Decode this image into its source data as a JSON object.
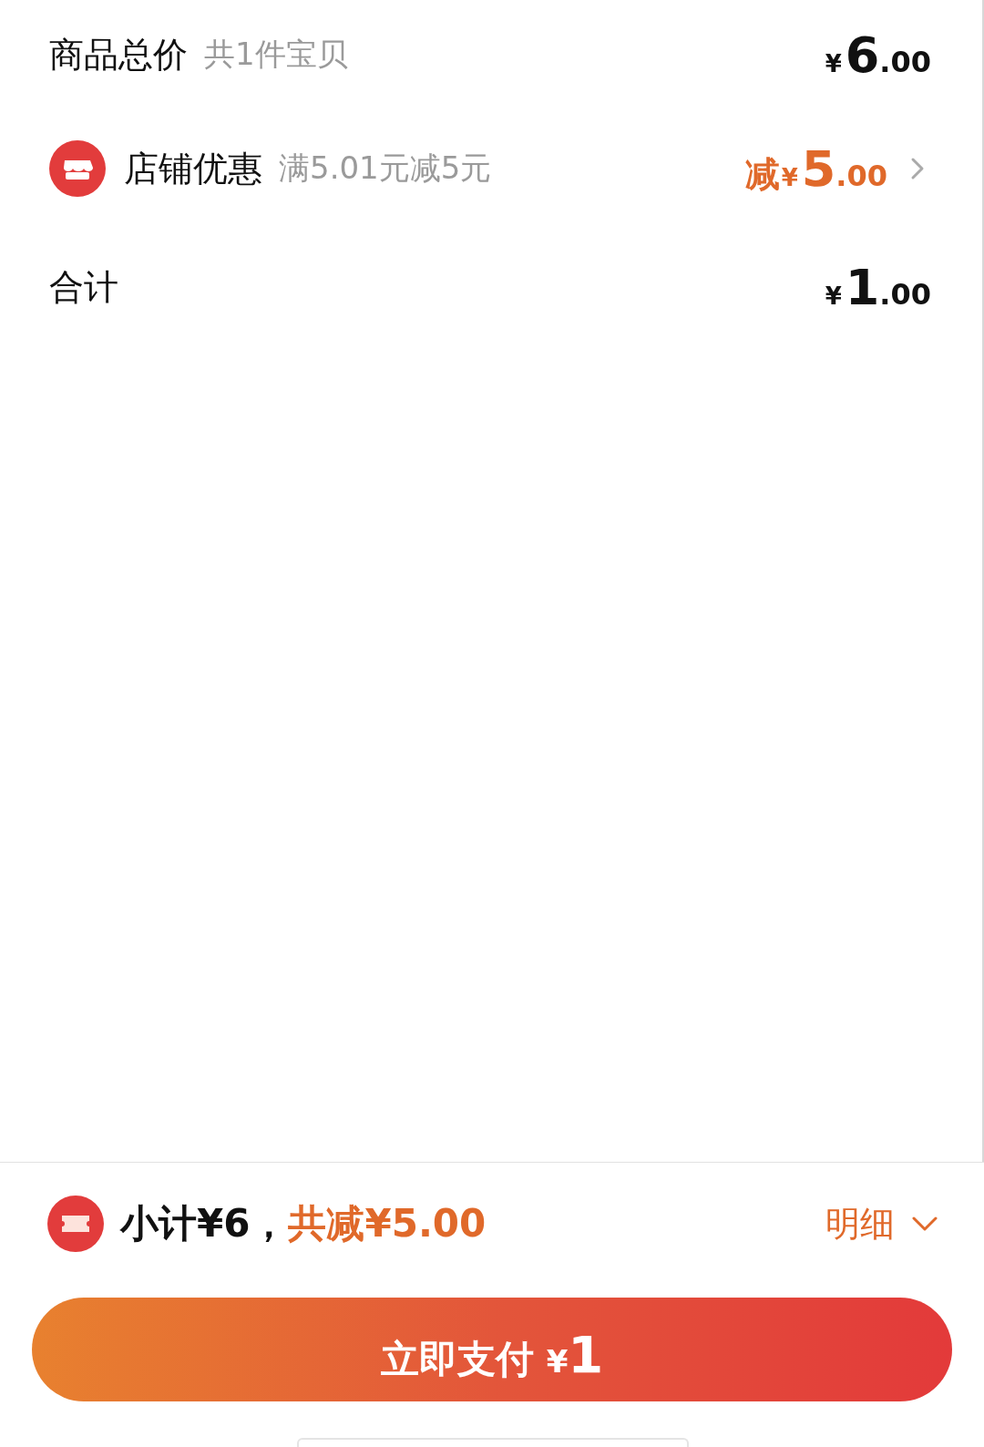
{
  "summary": [
    {
      "kind": "plain",
      "label": "商品总价",
      "note": "共1件宝贝",
      "price": {
        "symbol": "¥",
        "integer": "6",
        "decimal": ".00"
      }
    },
    {
      "kind": "discount",
      "label": "店铺优惠",
      "note": "满5.01元减5元",
      "price": {
        "prefix": "减",
        "symbol": "¥",
        "integer": "5",
        "decimal": ".00"
      }
    },
    {
      "kind": "plain",
      "label": "合计",
      "price": {
        "symbol": "¥",
        "integer": "1",
        "decimal": ".00"
      }
    }
  ],
  "footer": {
    "subtotal": "小计¥6，",
    "saving": "共减¥5.00",
    "details": "明细",
    "pay_button": {
      "label": "立即支付",
      "symbol": "¥",
      "amount": "1"
    }
  }
}
